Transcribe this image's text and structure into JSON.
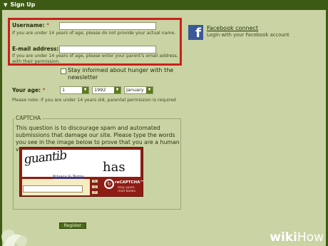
{
  "header": {
    "title": "Sign Up"
  },
  "form": {
    "username": {
      "label": "Username:",
      "required_mark": "*",
      "value": "",
      "note": "If you are under 14 years of age, please do not provide your actual name."
    },
    "email": {
      "label": "E-mail address:",
      "required_mark": "*",
      "value": "",
      "note": "If you are under 14 years of age, please enter your parent's email address, with their permission."
    },
    "newsletter": {
      "label": "Stay informed about hunger with the newsletter",
      "checked": false
    },
    "age": {
      "label": "Your age:",
      "required_mark": "*",
      "day": "1",
      "year": "1992",
      "month": "January",
      "note": "Please note: if you are under 14 years old, parental permission is required"
    }
  },
  "facebook": {
    "icon": "facebook-icon",
    "link_label": "Facebook connect",
    "subtext": "Login with your Facebook account",
    "color": "#3b5998"
  },
  "captcha": {
    "legend": "CAPTCHA",
    "description": "This question is to discourage spam and automated submissions that damage our site. Please type the words you see in the image below to prove that you are a human visitor.",
    "word1": "guantib",
    "word2": "has",
    "privacy_label": "Privacy & Terms",
    "answer": "",
    "brand": "reCAPTCHA™",
    "tagline": "stop spam. read books.",
    "color": "#8f1d14"
  },
  "register_label": "Register",
  "watermark": {
    "wiki": "wiki",
    "how": "How"
  },
  "theme": {
    "background": "#c9d3a3",
    "header": "#3d5a14",
    "highlight": "#c8211b"
  }
}
